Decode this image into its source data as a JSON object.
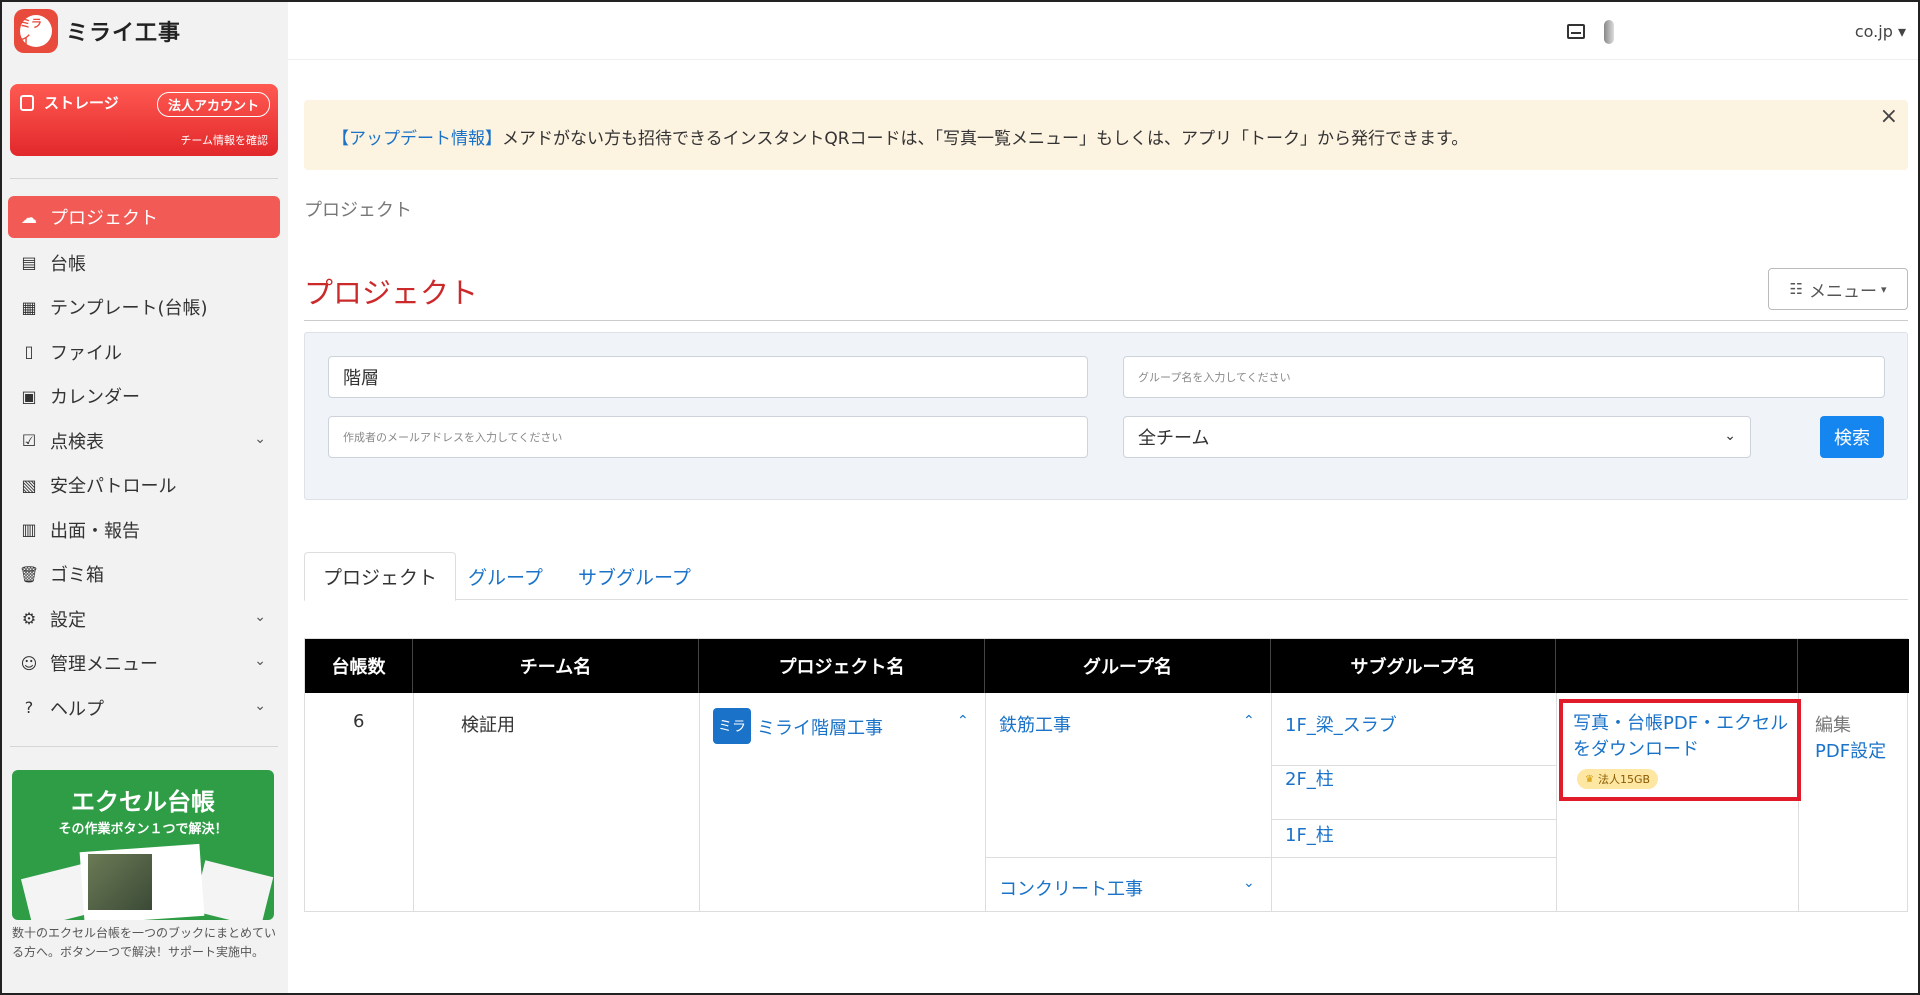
{
  "app": {
    "logo_mark": "ミライ",
    "logo_text": "ミライ工事"
  },
  "header": {
    "user_domain": "co.jp",
    "caret": "▾"
  },
  "storage": {
    "label": "ストレージ",
    "badge": "法人アカウント",
    "sub": "チーム情報を確認"
  },
  "nav": {
    "items": [
      {
        "label": "プロジェクト",
        "icon": "project-icon",
        "active": true
      },
      {
        "label": "台帳",
        "icon": "ledger-icon"
      },
      {
        "label": "テンプレート(台帳)",
        "icon": "template-icon"
      },
      {
        "label": "ファイル",
        "icon": "file-icon"
      },
      {
        "label": "カレンダー",
        "icon": "calendar-icon"
      },
      {
        "label": "点検表",
        "icon": "checklist-icon",
        "expandable": true
      },
      {
        "label": "安全パトロール",
        "icon": "patrol-icon"
      },
      {
        "label": "出面・報告",
        "icon": "report-icon"
      },
      {
        "label": "ゴミ箱",
        "icon": "trash-icon"
      },
      {
        "label": "設定",
        "icon": "gear-icon",
        "expandable": true
      },
      {
        "label": "管理メニュー",
        "icon": "users-icon",
        "expandable": true
      },
      {
        "label": "ヘルプ",
        "icon": "help-icon",
        "expandable": true
      }
    ]
  },
  "promo": {
    "title": "エクセル台帳",
    "subtitle": "その作業ボタン１つで解決！",
    "caption": "数十のエクセル台帳を一つのブックにまとめている方へ。ボタン一つで解決！サポート実施中。"
  },
  "alert": {
    "link": "【アップデート情報】",
    "message": "メアドがない方も招待できるインスタントQRコードは、「写真一覧メニュー」もしくは、アプリ「トーク」から発行できます。",
    "close": "×"
  },
  "breadcrumb": "プロジェクト",
  "page_title": "プロジェクト",
  "menu_button": {
    "label": "メニュー",
    "caret": "▾",
    "icon": "list-icon"
  },
  "search": {
    "hierarchy_value": "階層",
    "group_placeholder": "グループ名を入力してください",
    "email_placeholder": "作成者のメールアドレスを入力してください",
    "team_value": "全チーム",
    "submit": "検索"
  },
  "tabs": [
    {
      "label": "プロジェクト",
      "active": true
    },
    {
      "label": "グループ"
    },
    {
      "label": "サブグループ"
    }
  ],
  "table": {
    "headers": [
      "台帳数",
      "チーム名",
      "プロジェクト名",
      "グループ名",
      "サブグループ名",
      "",
      ""
    ],
    "row": {
      "count": "6",
      "team": "検証用",
      "project_badge": "ミラ",
      "project": "ミライ階層工事",
      "groups": [
        "鉄筋工事",
        "コンクリート工事"
      ],
      "subgroups": [
        "1F_梁_スラブ",
        "2F_柱",
        "1F_柱"
      ],
      "download": "写真・台帳PDF・エクセルをダウンロード",
      "plan_badge": "法人15GB",
      "edit": "編集",
      "pdf_settings": "PDF設定"
    }
  },
  "colors": {
    "brand_red": "#e84a3c",
    "link_blue": "#1a73c8",
    "primary_blue": "#1586f0",
    "highlight_red": "#e21b2a"
  }
}
